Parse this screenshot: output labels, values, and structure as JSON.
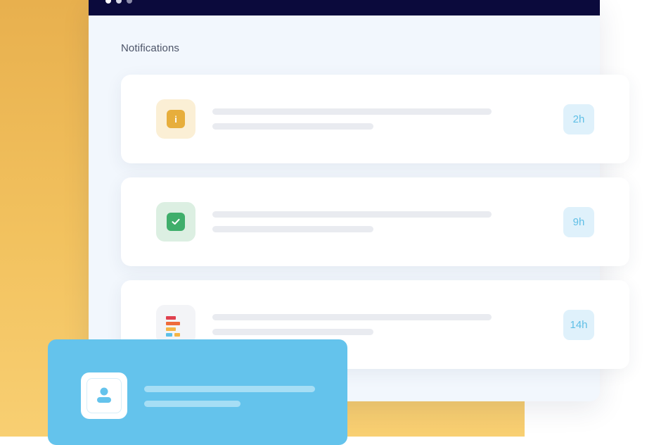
{
  "header": {
    "title": "Notifications"
  },
  "colors": {
    "background_yellow": "#f2c25f",
    "window_bg": "#f2f7fd",
    "titlebar": "#0b0a3c",
    "badge_text": "#5fbfe6",
    "profile_card": "#64c3ec"
  },
  "notifications": [
    {
      "icon": "info-icon",
      "time": "2h"
    },
    {
      "icon": "check-icon",
      "time": "9h"
    },
    {
      "icon": "app-logo-icon",
      "time": "14h"
    }
  ],
  "profile_card": {
    "icon": "user-icon"
  }
}
